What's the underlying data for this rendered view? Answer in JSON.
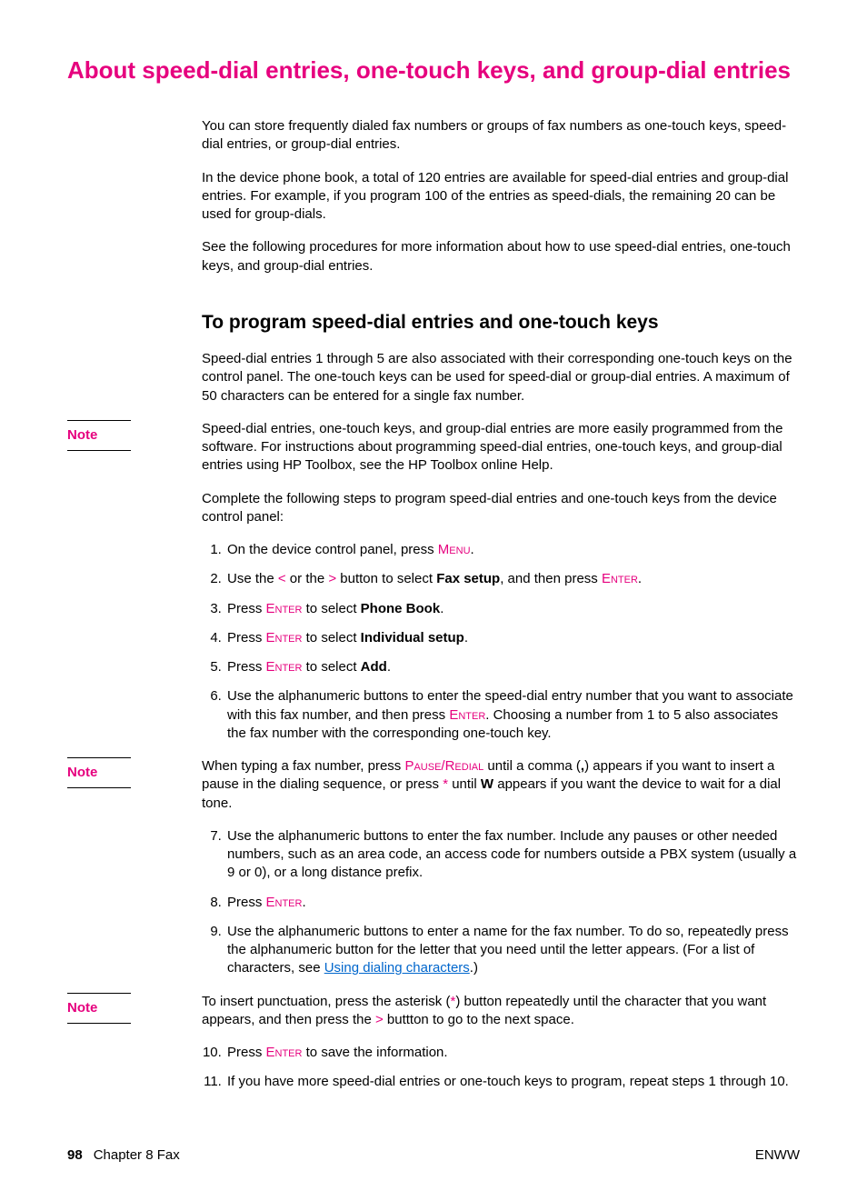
{
  "title": "About speed-dial entries, one-touch keys, and group-dial entries",
  "intro": {
    "p1": "You can store frequently dialed fax numbers or groups of fax numbers as one-touch keys, speed-dial entries, or group-dial entries.",
    "p2": "In the device phone book, a total of 120 entries are available for speed-dial entries and group-dial entries. For example, if you program 100 of the entries as speed-dials, the remaining 20 can be used for group-dials.",
    "p3": "See the following procedures for more information about how to use speed-dial entries, one-touch keys, and group-dial entries."
  },
  "section1": {
    "heading": "To program speed-dial entries and one-touch keys",
    "p1": "Speed-dial entries 1 through 5 are also associated with their corresponding one-touch keys on the control panel. The one-touch keys can be used for speed-dial or group-dial entries. A maximum of 50 characters can be entered for a single fax number."
  },
  "notes": {
    "label": "Note",
    "n1": "Speed-dial entries, one-touch keys, and group-dial entries are more easily programmed from the software. For instructions about programming speed-dial entries, one-touch keys, and group-dial entries using HP Toolbox, see the HP Toolbox online Help.",
    "n2_a": "When typing a fax number, press ",
    "n2_key": "Pause/Redial",
    "n2_b": " until a comma (",
    "n2_comma": ",",
    "n2_c": ") appears if you want to insert a pause in the dialing sequence, or press ",
    "n2_star": "*",
    "n2_d": " until ",
    "n2_w": "W",
    "n2_e": " appears if you want the device to wait for a dial tone.",
    "n3_a": "To insert punctuation, press the asterisk (",
    "n3_star": "*",
    "n3_b": ") button repeatedly until the character that you want appears, and then press the ",
    "n3_gt": ">",
    "n3_c": " buttton to go to the next space."
  },
  "stepsIntro": "Complete the following steps to program speed-dial entries and one-touch keys from the device control panel:",
  "steps": {
    "s1_a": "On the device control panel, press ",
    "s1_key": "Menu",
    "s1_b": ".",
    "s2_a": "Use the ",
    "s2_lt": "<",
    "s2_b": " or the ",
    "s2_gt": ">",
    "s2_c": " button to select ",
    "s2_bold": "Fax setup",
    "s2_d": ", and then press ",
    "s2_key": "Enter",
    "s2_e": ".",
    "s3_a": "Press ",
    "s3_key": "Enter",
    "s3_b": " to select ",
    "s3_bold": "Phone Book",
    "s3_c": ".",
    "s4_a": "Press ",
    "s4_key": "Enter",
    "s4_b": " to select ",
    "s4_bold": "Individual setup",
    "s4_c": ".",
    "s5_a": "Press ",
    "s5_key": "Enter",
    "s5_b": " to select ",
    "s5_bold": "Add",
    "s5_c": ".",
    "s6_a": "Use the alphanumeric buttons to enter the speed-dial entry number that you want to associate with this fax number, and then press ",
    "s6_key": "Enter",
    "s6_b": ". Choosing a number from 1 to 5 also associates the fax number with the corresponding one-touch key.",
    "s7": "Use the alphanumeric buttons to enter the fax number. Include any pauses or other needed numbers, such as an area code, an access code for numbers outside a PBX system (usually a 9 or 0), or a long distance prefix.",
    "s8_a": "Press ",
    "s8_key": "Enter",
    "s8_b": ".",
    "s9_a": "Use the alphanumeric buttons to enter a name for the fax number. To do so, repeatedly press the alphanumeric button for the letter that you need until the letter appears. (For a list of characters, see ",
    "s9_link": "Using dialing characters",
    "s9_b": ".)",
    "s10_a": "Press ",
    "s10_key": "Enter",
    "s10_b": " to save the information.",
    "s11": "If you have more speed-dial entries or one-touch keys to program, repeat steps 1 through 10."
  },
  "footer": {
    "pageNum": "98",
    "chapter": "Chapter 8  Fax",
    "right": "ENWW"
  }
}
